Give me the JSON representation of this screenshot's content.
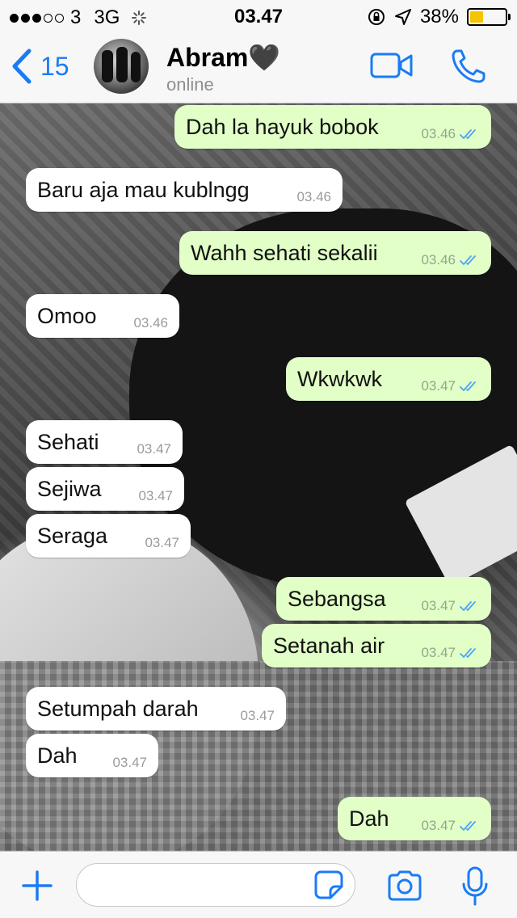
{
  "status_bar": {
    "carrier": "3",
    "network": "3G",
    "time": "03.47",
    "battery_percent": "38%",
    "battery_level": 0.38,
    "signal_bars_filled": 3,
    "signal_bars_total": 5
  },
  "header": {
    "back_count": "15",
    "contact_name": "Abram🖤",
    "contact_status": "online",
    "accent_color": "#1a7cf5"
  },
  "messages": [
    {
      "text": "Dah la hayuk bobok",
      "time": "03.46",
      "direction": "out"
    },
    {
      "text": "Baru aja mau kublngg",
      "time": "03.46",
      "direction": "in"
    },
    {
      "text": "Wahh sehati sekalii",
      "time": "03.46",
      "direction": "out"
    },
    {
      "text": "Omoo",
      "time": "03.46",
      "direction": "in"
    },
    {
      "text": "Wkwkwk",
      "time": "03.47",
      "direction": "out"
    },
    {
      "text": "Sehati",
      "time": "03.47",
      "direction": "in"
    },
    {
      "text": "Sejiwa",
      "time": "03.47",
      "direction": "in"
    },
    {
      "text": "Seraga",
      "time": "03.47",
      "direction": "in"
    },
    {
      "text": "Sebangsa",
      "time": "03.47",
      "direction": "out"
    },
    {
      "text": "Setanah air",
      "time": "03.47",
      "direction": "out"
    },
    {
      "text": "Setumpah darah",
      "time": "03.47",
      "direction": "in"
    },
    {
      "text": "Dah",
      "time": "03.47",
      "direction": "in"
    },
    {
      "text": "Dah",
      "time": "03.47",
      "direction": "out"
    }
  ],
  "input_bar": {
    "message_value": "",
    "message_placeholder": ""
  },
  "colors": {
    "outgoing_bubble": "#e1ffc7",
    "incoming_bubble": "#ffffff",
    "read_ticks": "#4fa3f7"
  }
}
